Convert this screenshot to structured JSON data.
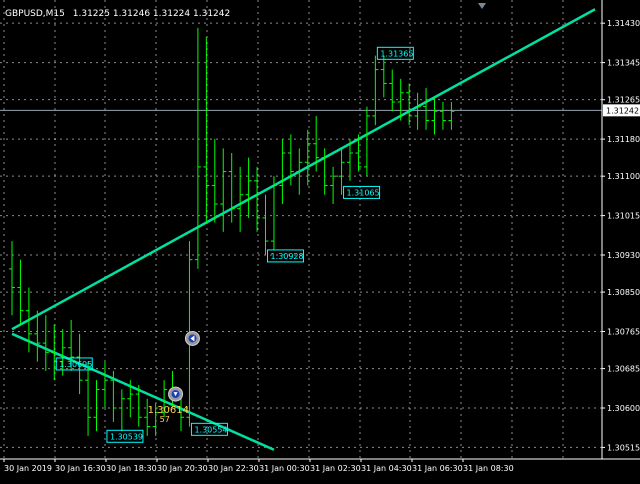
{
  "header": {
    "symbol_timeframe": "GBPUSD,M15",
    "ohlc": "1.31225 1.31246 1.31224 1.31242"
  },
  "colors": {
    "background": "#000000",
    "grid": "#ffffff",
    "bull": "#00ff00",
    "bear": "#00ff00",
    "trendline": "#00e0a0",
    "label_text": "#00ffff",
    "label_border": "#00ffff",
    "bid_line": "#9aa4b0",
    "axis_text": "#ffffff",
    "signal_text": "#ffd24a"
  },
  "chart_data": {
    "type": "candlestick",
    "symbol": "GBPUSD",
    "timeframe": "M15",
    "y_range": [
      1.3049,
      1.3148
    ],
    "y_ticks": [
      "1.31430",
      "1.31345",
      "1.31265",
      "1.31180",
      "1.31100",
      "1.31015",
      "1.30930",
      "1.30850",
      "1.30765",
      "1.30685",
      "1.30600",
      "1.30515"
    ],
    "x_ticks": [
      "30 Jan 2019",
      "30 Jan 16:30",
      "30 Jan 18:30",
      "30 Jan 20:30",
      "30 Jan 22:30",
      "31 Jan 00:30",
      "31 Jan 02:30",
      "31 Jan 04:30",
      "31 Jan 06:30",
      "31 Jan 08:30"
    ],
    "current_price": "1.31242",
    "current_price_value": 1.31242,
    "candles": [
      [
        1.309,
        1.3096,
        1.308,
        1.3086
      ],
      [
        1.3086,
        1.3092,
        1.3078,
        1.3081
      ],
      [
        1.3081,
        1.3086,
        1.3072,
        1.3076
      ],
      [
        1.3076,
        1.3081,
        1.307,
        1.3074
      ],
      [
        1.3074,
        1.308,
        1.3068,
        1.3072
      ],
      [
        1.3072,
        1.3078,
        1.3066,
        1.307
      ],
      [
        1.307,
        1.3077,
        1.3067,
        1.3073
      ],
      [
        1.3073,
        1.3079,
        1.3068,
        1.3071
      ],
      [
        1.3071,
        1.3076,
        1.3063,
        1.3066
      ],
      [
        1.3066,
        1.307,
        1.3054,
        1.3058
      ],
      [
        1.3058,
        1.3066,
        1.3055,
        1.3064
      ],
      [
        1.3064,
        1.307,
        1.306,
        1.3066
      ],
      [
        1.3066,
        1.3068,
        1.3057,
        1.306
      ],
      [
        1.306,
        1.3064,
        1.3055,
        1.3062
      ],
      [
        1.3062,
        1.3066,
        1.3058,
        1.3063
      ],
      [
        1.3063,
        1.3065,
        1.3056,
        1.3058
      ],
      [
        1.3058,
        1.3062,
        1.3054,
        1.3056
      ],
      [
        1.3056,
        1.3061,
        1.3054,
        1.3059
      ],
      [
        1.3059,
        1.3066,
        1.3058,
        1.3064
      ],
      [
        1.3064,
        1.3068,
        1.306,
        1.3062
      ],
      [
        1.3062,
        1.3064,
        1.3055,
        1.3058
      ],
      [
        1.3058,
        1.3096,
        1.3056,
        1.3092
      ],
      [
        1.3092,
        1.3142,
        1.309,
        1.3112
      ],
      [
        1.3112,
        1.314,
        1.31,
        1.3108
      ],
      [
        1.3108,
        1.3118,
        1.31,
        1.3104
      ],
      [
        1.3104,
        1.3116,
        1.3098,
        1.3111
      ],
      [
        1.3111,
        1.3115,
        1.31,
        1.3103
      ],
      [
        1.3103,
        1.3112,
        1.3098,
        1.3106
      ],
      [
        1.3106,
        1.3114,
        1.3101,
        1.3109
      ],
      [
        1.3109,
        1.3112,
        1.3098,
        1.3101
      ],
      [
        1.3101,
        1.3106,
        1.3093,
        1.3096
      ],
      [
        1.3096,
        1.311,
        1.3094,
        1.3108
      ],
      [
        1.3108,
        1.3118,
        1.3104,
        1.3115
      ],
      [
        1.3115,
        1.3119,
        1.3108,
        1.3111
      ],
      [
        1.3111,
        1.3116,
        1.3106,
        1.3113
      ],
      [
        1.3113,
        1.312,
        1.3108,
        1.3117
      ],
      [
        1.3117,
        1.3123,
        1.3111,
        1.3114
      ],
      [
        1.3114,
        1.3116,
        1.3106,
        1.3108
      ],
      [
        1.3108,
        1.3112,
        1.3104,
        1.311
      ],
      [
        1.311,
        1.3116,
        1.3106,
        1.3113
      ],
      [
        1.3113,
        1.3118,
        1.3109,
        1.3115
      ],
      [
        1.3115,
        1.3119,
        1.3111,
        1.3112
      ],
      [
        1.3112,
        1.3125,
        1.311,
        1.3123
      ],
      [
        1.3123,
        1.3136,
        1.3121,
        1.3133
      ],
      [
        1.3133,
        1.3136,
        1.3127,
        1.313
      ],
      [
        1.313,
        1.3133,
        1.3124,
        1.3126
      ],
      [
        1.3126,
        1.3131,
        1.3122,
        1.3128
      ],
      [
        1.3128,
        1.313,
        1.3121,
        1.3123
      ],
      [
        1.3123,
        1.3128,
        1.312,
        1.3125
      ],
      [
        1.3125,
        1.3129,
        1.312,
        1.3122
      ],
      [
        1.3122,
        1.3127,
        1.3119,
        1.3124
      ],
      [
        1.3124,
        1.3126,
        1.312,
        1.3122
      ],
      [
        1.3122,
        1.3126,
        1.312,
        1.3124
      ]
    ],
    "trendlines": [
      {
        "name": "resistance",
        "from": [
          0,
          1.3077
        ],
        "to": [
          69,
          1.3146
        ]
      },
      {
        "name": "support-down",
        "from": [
          0,
          1.3076
        ],
        "to": [
          31,
          1.3051
        ]
      }
    ],
    "price_labels": [
      {
        "text": "1.31365",
        "index": 43,
        "price": 1.31365
      },
      {
        "text": "1.31065",
        "index": 39,
        "price": 1.31065
      },
      {
        "text": "1.30928",
        "index": 30,
        "price": 1.30928
      },
      {
        "text": "1.30695",
        "index": 5,
        "price": 1.30695
      },
      {
        "text": "1.30539",
        "index": 11,
        "price": 1.30539
      },
      {
        "text": "1.30554",
        "index": 21,
        "price": 1.30554
      }
    ],
    "signals": [
      {
        "index": 21,
        "price": 1.3075,
        "kind": "up"
      },
      {
        "index": 19,
        "price": 1.3063,
        "kind": "down"
      }
    ],
    "signal_text": {
      "text": "1.30614",
      "sub": "57",
      "index": 17,
      "price": 1.306
    }
  }
}
